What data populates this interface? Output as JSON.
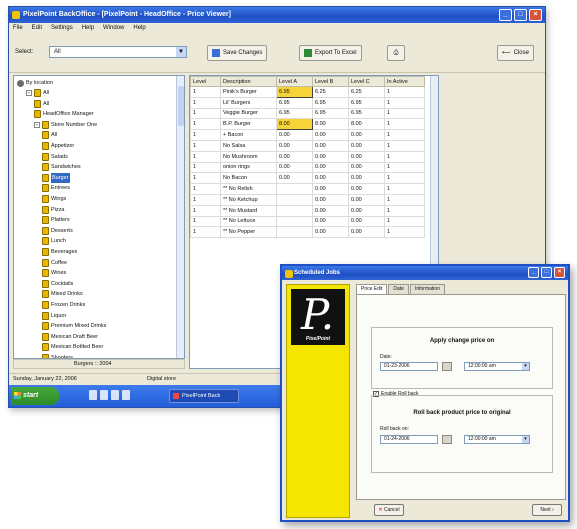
{
  "main_window": {
    "title": "PixelPoint BackOffice - [PixelPoint - HeadOffice - Price Viewer]",
    "menu": [
      "File",
      "Edit",
      "Settings",
      "Help",
      "Window",
      "Help"
    ],
    "select_label": "Select:",
    "select_value": "All",
    "buttons": {
      "save_changes": "Save Changes",
      "export": "Export To Excel",
      "close": "Close"
    }
  },
  "tree": {
    "root": "By location",
    "nodes": [
      {
        "label": "All",
        "level": 1
      },
      {
        "label": "All",
        "level": 2
      },
      {
        "label": "HeadOffice Manager",
        "level": 2
      },
      {
        "label": "Store Number One",
        "level": 2
      },
      {
        "label": "All",
        "level": 3
      },
      {
        "label": "Appetizer",
        "level": 3
      },
      {
        "label": "Salads",
        "level": 3
      },
      {
        "label": "Sandwiches",
        "level": 3
      },
      {
        "label": "Burger",
        "level": 3,
        "selected": true
      },
      {
        "label": "Entrees",
        "level": 3
      },
      {
        "label": "Wings",
        "level": 3
      },
      {
        "label": "Pizza",
        "level": 3
      },
      {
        "label": "Platters",
        "level": 3
      },
      {
        "label": "Desserts",
        "level": 3
      },
      {
        "label": "Lunch",
        "level": 3
      },
      {
        "label": "Beverages",
        "level": 3
      },
      {
        "label": "Coffee",
        "level": 3
      },
      {
        "label": "Wines",
        "level": 3
      },
      {
        "label": "Cocktails",
        "level": 3
      },
      {
        "label": "Mixed Drinks",
        "level": 3
      },
      {
        "label": "Frozen Drinks",
        "level": 3
      },
      {
        "label": "Liquor",
        "level": 3
      },
      {
        "label": "Premium Mixed Drinks",
        "level": 3
      },
      {
        "label": "Mexican Draft Beer",
        "level": 3
      },
      {
        "label": "Mexican Bottled Beer",
        "level": 3
      },
      {
        "label": "Shooters",
        "level": 3
      }
    ],
    "status": "Burgers :: 2004"
  },
  "grid": {
    "columns": [
      "Level",
      "Description",
      "Level A",
      "Level B",
      "Level C",
      "In Active"
    ],
    "rows": [
      [
        "1",
        "Pinik's Burger",
        "6.95",
        "6.25",
        "6.25",
        "1"
      ],
      [
        "1",
        "Lil' Burgers",
        "6.95",
        "6.95",
        "6.95",
        "1"
      ],
      [
        "1",
        "Veggie Burger",
        "6.95",
        "6.95",
        "6.95",
        "1"
      ],
      [
        "1",
        "B.P. Burger",
        "8.00",
        "8.00",
        "8.00",
        "1"
      ],
      [
        "1",
        "+ Bacon",
        "0.00",
        "0.00",
        "0.00",
        "1"
      ],
      [
        "1",
        "No Salsa",
        "0.00",
        "0.00",
        "0.00",
        "1"
      ],
      [
        "1",
        "No Mushroom",
        "0.00",
        "0.00",
        "0.00",
        "1"
      ],
      [
        "1",
        "onion rings",
        "0.00",
        "0.00",
        "0.00",
        "1"
      ],
      [
        "1",
        "No Bacon",
        "0.00",
        "0.00",
        "0.00",
        "1"
      ],
      [
        "1",
        "** No Relish",
        "",
        "0.00",
        "0.00",
        "1"
      ],
      [
        "1",
        "** No Ketchup",
        "",
        "0.00",
        "0.00",
        "1"
      ],
      [
        "1",
        "** No Mustard",
        "",
        "0.00",
        "0.00",
        "1"
      ],
      [
        "1",
        "** No Lettuce",
        "",
        "0.00",
        "0.00",
        "1"
      ],
      [
        "1",
        "** No Pepper",
        "",
        "0.00",
        "0.00",
        "1"
      ]
    ]
  },
  "statusbar": {
    "left": "Sunday, January 22, 2006",
    "right": "Digital store"
  },
  "taskbar": {
    "start": "start",
    "item": "PixelPoint Back"
  },
  "dialog": {
    "title": "Scheduled Jobs",
    "logo_text": "PixelPoint",
    "tabs": [
      "Price Edit",
      "Date",
      "Information"
    ],
    "group1_title": "Apply change price on",
    "group1_label": "Date:",
    "group1_date": "01-23-2006",
    "group1_time": "12:00:00 am",
    "checkbox_label": "Enable Roll back",
    "group2_title": "Roll back product price to original",
    "group2_label": "Roll back on:",
    "group2_date": "01-24-2006",
    "group2_time": "12:00:00 am",
    "cancel": "Cancel",
    "next": "Next"
  }
}
